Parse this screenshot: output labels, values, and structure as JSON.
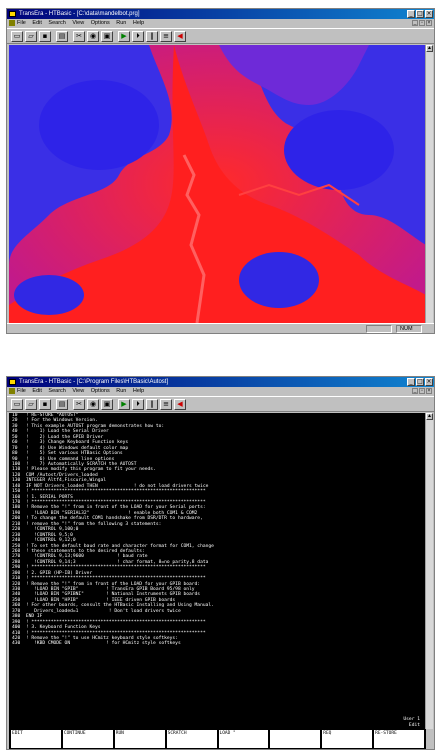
{
  "window1": {
    "title": "TransEra - HTBasic - [C:\\data\\mandelbot.prg]",
    "menus": [
      "File",
      "Edit",
      "Search",
      "View",
      "Options",
      "Run",
      "Help"
    ],
    "status": "NUM"
  },
  "window2": {
    "title": "TransEra - HTBasic - [C:\\Program Files\\HTBasic\\Autost]",
    "menus": [
      "File",
      "Edit",
      "Search",
      "View",
      "Options",
      "Run",
      "Help"
    ],
    "code_lines": [
      "10   ! RE-STORE \"AUTOST\"",
      "20   ! For the Windows Version.",
      "30   ! This example AUTOST program demonstrates how to:",
      "40   !    1) Load the Serial Driver",
      "50   !    2) Load the GPIB Driver",
      "60   !    3) Change Keyboard Function keys",
      "70   !    4) Use Windows default color map",
      "80   !    5) Set various HTBasic Options",
      "90   !    6) Use command line options",
      "100  !    7) Automatically SCRATCH the AUTOST",
      "110  ! Please modify this program to fit your needs.",
      "120  COM /Autost/Drivers_loaded",
      "130  INTEGER Altf4,Fiscurie,Wingal",
      "140  IF NOT Drivers_loaded THEN             ! do not load drivers twice",
      "150  ! ***************************************************************",
      "160  ! 1. SERIAL PORTS",
      "170  ! ***************************************************************",
      "180  ! Remove the \"!\" from in front of the LOAD for your Serial ports:",
      "190     !LOAD BIN \"SERIAL32\"              ! enable both COM1 & COM2",
      "200  ! To change the default COM1 handshake from DSR/DTR to hardware,",
      "210  ! remove the \"!\" from the following 3 statements:",
      "220     !CONTROL 9,100;0",
      "230     !CONTROL 9,5;0",
      "240     !CONTROL 9,12;0",
      "250  ! To set the default baud rate and character format for COM1, change",
      "260  ! these statements to the desired defaults:",
      "270     !CONTROL 9,13;9600            ! baud rate",
      "280     !CONTROL 9,14;3               ! char format, 8=no parity,8 data",
      "290  ! ***************************************************************",
      "300  ! 2. GPIB (HP-IB) Driver",
      "310  ! ***************************************************************",
      "320  ! Remove the \"!\" from in front of the LOAD for your GPIB board:",
      "330     !LOAD BIN \"GPIB\"          ! TransEra GPIB Board 95/98 only",
      "340     !LOAD BIN \"GPIBNI\"        ! National Instruments GPIB boards",
      "350     !LOAD BIN \"HPIB\"          ! IEEE driven GPIB boards",
      "360  ! For other boards, consult the HTBasic Installing and Using Manual.",
      "370     Drivers_loaded=1           ! Don't load drivers twice",
      "380  END IF",
      "390  ! ***************************************************************",
      "400  ! 3. Keyboard Function Keys",
      "410  ! ***************************************************************",
      "420  ! Remove the \"!\" to use HCmitz keyboard style softkeys:",
      "430     !KBD CMODE ON             ! for HCmitz style softkeys"
    ],
    "user_indicator": "User 1",
    "edit_indicator": "Edit",
    "fkeys": [
      "EDIT",
      "CONTINUE",
      "RUN",
      "SCRATCH",
      "LOAD \"",
      "",
      "REQ",
      "RE-STORE"
    ]
  }
}
